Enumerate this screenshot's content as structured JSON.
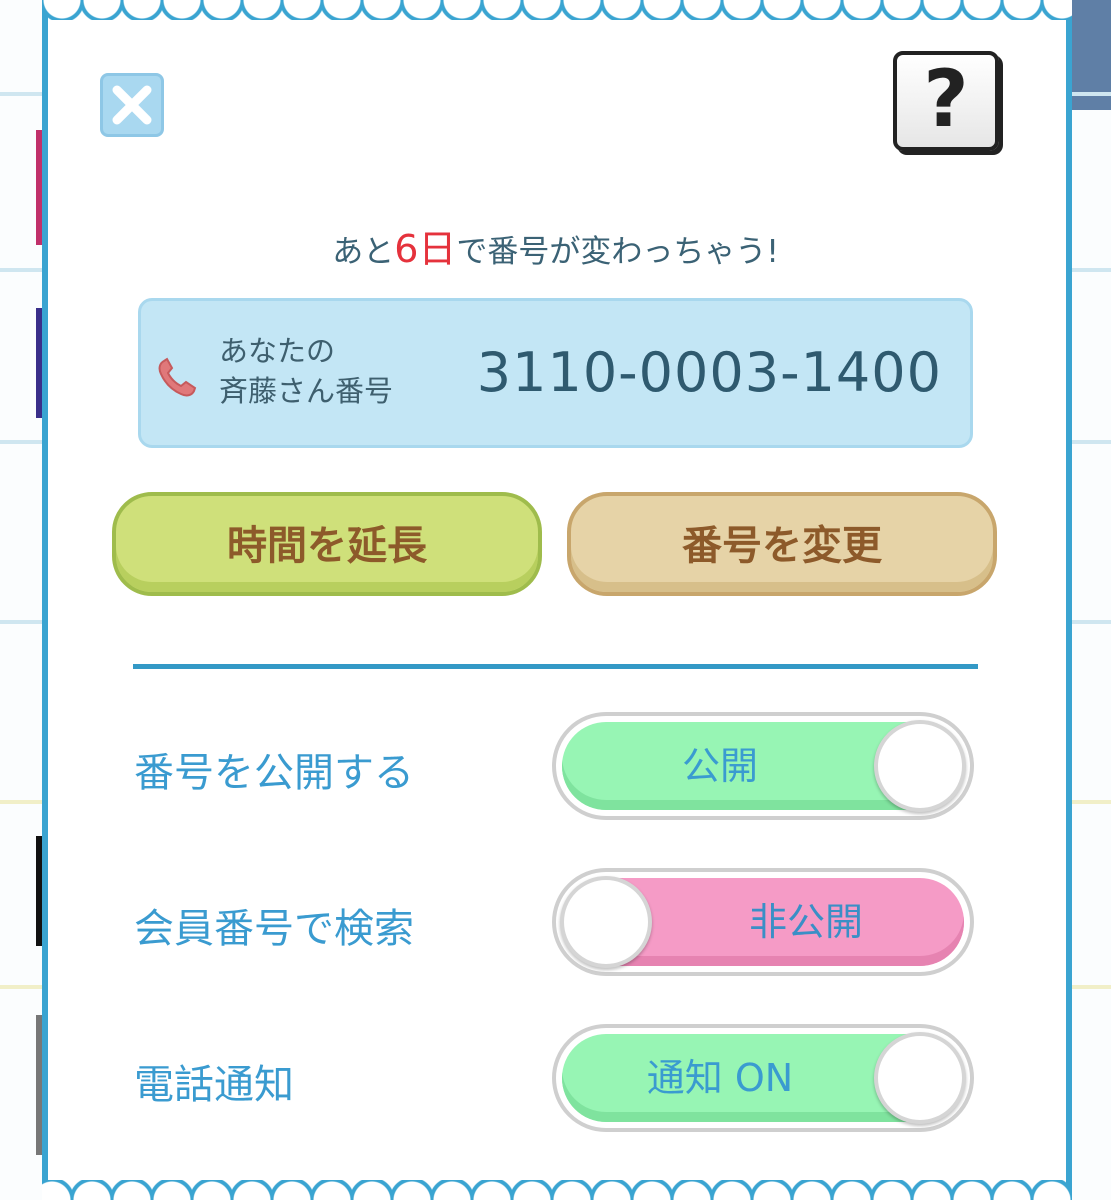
{
  "modal": {
    "countdown": {
      "prefix": "あと",
      "days": "6日",
      "suffix": "で番号が変わっちゃう!"
    },
    "number_card": {
      "label_line1": "あなたの",
      "label_line2": "斉藤さん番号",
      "number": "3110-0003-1400"
    },
    "buttons": {
      "extend": "時間を延長",
      "change": "番号を変更",
      "help": "?"
    },
    "settings": [
      {
        "label": "番号を公開する",
        "state": "公開",
        "on": true
      },
      {
        "label": "会員番号で検索",
        "state": "非公開",
        "on": false
      },
      {
        "label": "電話通知",
        "state": "通知 ON",
        "on": true
      }
    ]
  },
  "colors": {
    "frame": "#3aa4d1",
    "toggle_on": "#97f5b4",
    "toggle_off": "#f59bc6",
    "label": "#3a9bd0",
    "countdown_accent": "#e5323c"
  },
  "icons": [
    "close-icon",
    "help-icon",
    "phone-icon"
  ]
}
